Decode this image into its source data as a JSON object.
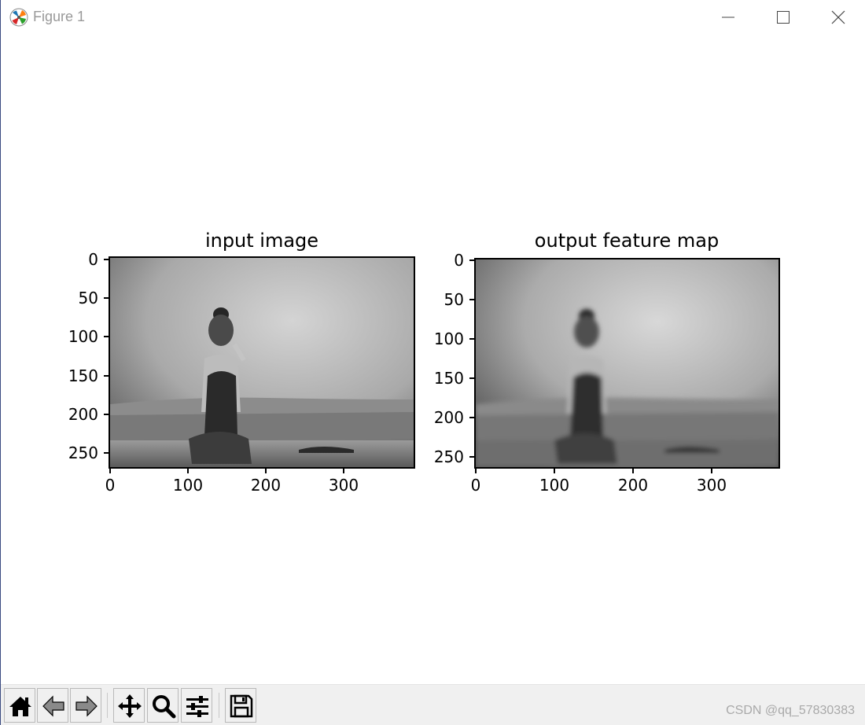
{
  "window": {
    "title": "Figure 1",
    "icon": "matplotlib-logo-icon",
    "controls": [
      "minimize-icon",
      "maximize-icon",
      "close-icon"
    ]
  },
  "figure": {
    "axes": [
      {
        "title": "input image",
        "image": "grayscale photo of a girl with backpack sitting on a wall overlooking a city",
        "y_ticks": [
          "0",
          "50",
          "100",
          "150",
          "200",
          "250"
        ],
        "x_ticks": [
          "0",
          "100",
          "200",
          "300"
        ]
      },
      {
        "title": "output feature map",
        "image": "blurred grayscale feature map of the same photo",
        "y_ticks": [
          "0",
          "50",
          "100",
          "150",
          "200",
          "250"
        ],
        "x_ticks": [
          "0",
          "100",
          "200",
          "300"
        ]
      }
    ]
  },
  "toolbar": {
    "buttons": [
      "home-icon",
      "back-icon",
      "forward-icon",
      "pan-icon",
      "zoom-icon",
      "configure-subplots-icon",
      "save-icon"
    ],
    "watermark": "CSDN @qq_57830383"
  }
}
